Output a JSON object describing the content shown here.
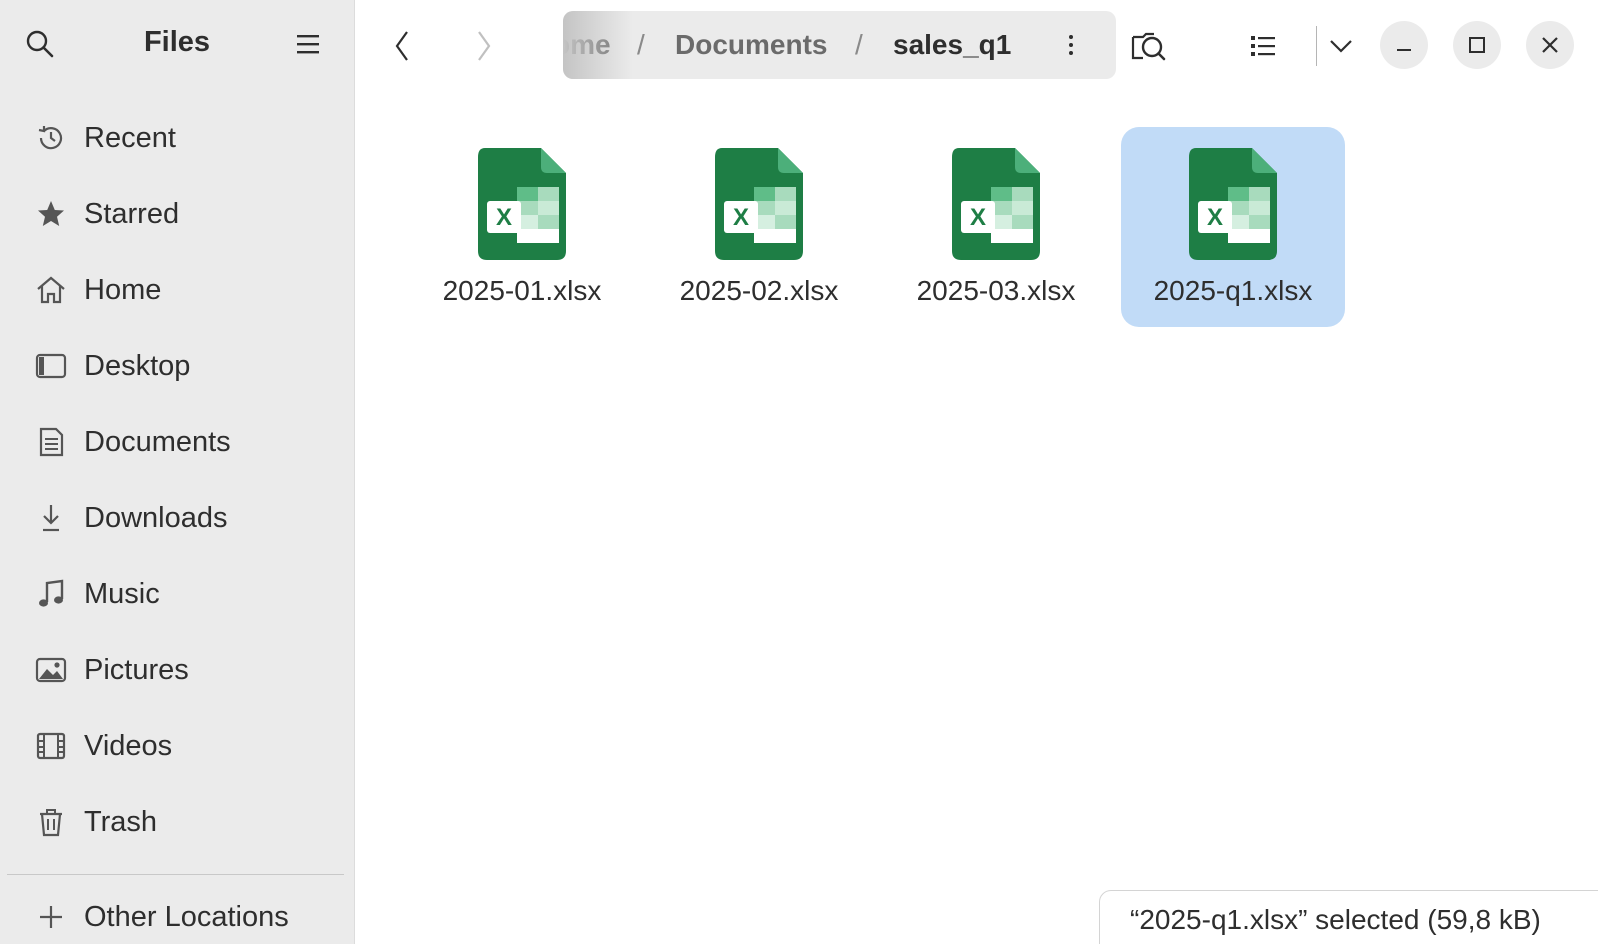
{
  "sidebar": {
    "title": "Files",
    "items": [
      {
        "label": "Recent",
        "icon": "clock-history-icon"
      },
      {
        "label": "Starred",
        "icon": "star-icon"
      },
      {
        "label": "Home",
        "icon": "home-icon"
      },
      {
        "label": "Desktop",
        "icon": "desktop-icon"
      },
      {
        "label": "Documents",
        "icon": "document-icon"
      },
      {
        "label": "Downloads",
        "icon": "download-icon"
      },
      {
        "label": "Music",
        "icon": "music-note-icon"
      },
      {
        "label": "Pictures",
        "icon": "picture-icon"
      },
      {
        "label": "Videos",
        "icon": "film-icon"
      },
      {
        "label": "Trash",
        "icon": "trash-icon"
      }
    ],
    "other_locations": "Other Locations"
  },
  "pathbar": {
    "crumbs": [
      "ome",
      "Documents",
      "sales_q1"
    ],
    "separator": "/"
  },
  "files": [
    {
      "name": "2025-01.xlsx",
      "selected": false
    },
    {
      "name": "2025-02.xlsx",
      "selected": false
    },
    {
      "name": "2025-03.xlsx",
      "selected": false
    },
    {
      "name": "2025-q1.xlsx",
      "selected": true
    }
  ],
  "status": {
    "text": "“2025-q1.xlsx” selected  (59,8 kB)"
  },
  "colors": {
    "selection": "#c1dbf7",
    "sidebar_bg": "#ebebeb",
    "excel_green": "#1e7e45"
  }
}
